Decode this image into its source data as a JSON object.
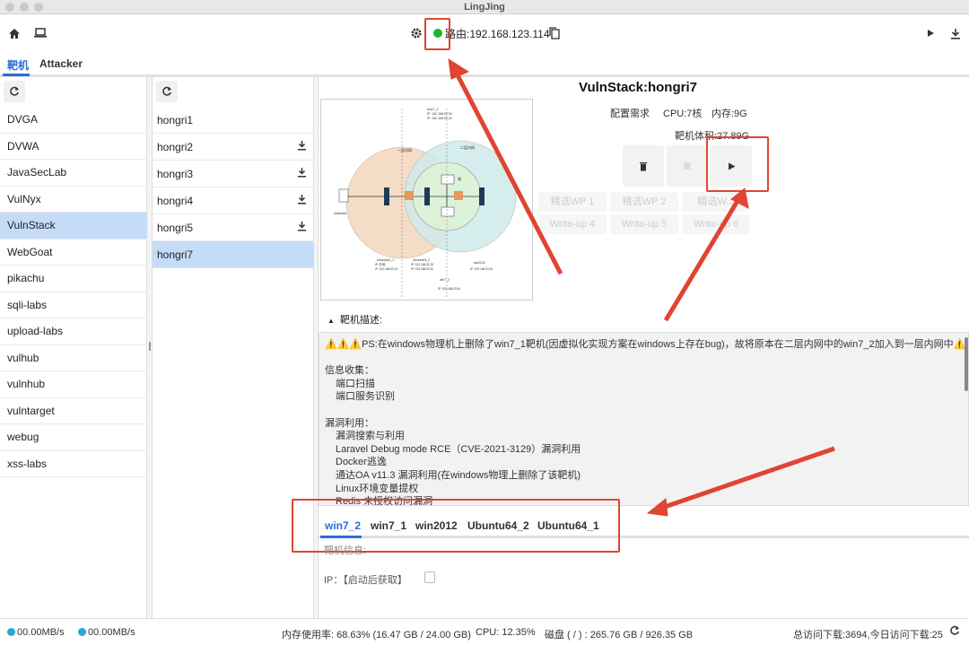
{
  "window": {
    "title": "LingJing"
  },
  "toolbar": {
    "route_text": "路由:192.168.123.114",
    "icons": [
      "home-icon",
      "laptop-icon",
      "gear-icon",
      "copy-icon",
      "play-icon",
      "download-icon"
    ]
  },
  "tabs": [
    {
      "label": "靶机",
      "active": true
    },
    {
      "label": "Attacker",
      "active": false
    }
  ],
  "labs": {
    "items": [
      "DVGA",
      "DVWA",
      "JavaSecLab",
      "VulNyx",
      "VulnStack",
      "WebGoat",
      "pikachu",
      "sqli-labs",
      "upload-labs",
      "vulhub",
      "vulnhub",
      "vulntarget",
      "webug",
      "xss-labs"
    ],
    "selected": "VulnStack"
  },
  "targets": {
    "items": [
      {
        "name": "hongri1",
        "download": false
      },
      {
        "name": "hongri2",
        "download": true
      },
      {
        "name": "hongri3",
        "download": true
      },
      {
        "name": "hongri4",
        "download": true
      },
      {
        "name": "hongri5",
        "download": true
      },
      {
        "name": "hongri7",
        "download": false
      }
    ],
    "selected": "hongri7"
  },
  "detail": {
    "title": "VulnStack:hongri7",
    "req_label": "配置需求",
    "cpu": "CPU:7核",
    "mem": "内存:9G",
    "size": "靶机体积:27.89G",
    "wp_buttons": [
      "精选WP 1",
      "精选WP 2",
      "精选W...",
      "Write-up 4",
      "Write-up 5",
      "Write-up 6"
    ],
    "desc_label": "靶机描述:",
    "desc_lines": [
      {
        "text": "⚠️⚠️⚠️PS:在windows物理机上删除了win7_1靶机(因虚拟化实现方案在windows上存在bug)，故将原本在二层内网中的win7_2加入到一层内网中⚠️⚠️⚠️",
        "indent": false
      },
      {
        "text": "",
        "indent": false
      },
      {
        "text": "信息收集：",
        "indent": false
      },
      {
        "text": "端口扫描",
        "indent": true
      },
      {
        "text": "端口服务识别",
        "indent": true
      },
      {
        "text": "",
        "indent": false
      },
      {
        "text": "漏洞利用：",
        "indent": false
      },
      {
        "text": "漏洞搜索与利用",
        "indent": true
      },
      {
        "text": "Laravel Debug mode RCE（CVE-2021-3129）漏洞利用",
        "indent": true
      },
      {
        "text": "Docker逃逸",
        "indent": true
      },
      {
        "text": "通达OA v11.3 漏洞利用(在windows物理上删除了该靶机)",
        "indent": true
      },
      {
        "text": "Linux环境变量提权",
        "indent": true
      },
      {
        "text": "Redis 未授权访问漏洞",
        "indent": true
      }
    ],
    "host_tabs": [
      "win7_2",
      "win7_1",
      "win2012",
      "Ubuntu64_2",
      "Ubuntu64_1"
    ],
    "host_active": "win7_2",
    "info_label": "靶机信息:",
    "ip_text": "IP：【启动后获取】"
  },
  "diagram": {
    "labels": [
      "win7_1",
      "IP: 192.168.52.30",
      "IP: 192.168.93.20",
      "一层内网",
      "二层内网",
      "域",
      "Attacker",
      "Ubuntu64_1",
      "Ubuntu64_2",
      "win2012",
      "win7_2",
      "IP: 192.168.52.10",
      "IP: 192.168.52.20",
      "IP: 192.168.93.10",
      "IP: 192.168.93.30",
      "IP: 192.168.93.40",
      "IP: 外网"
    ]
  },
  "status": {
    "up": "00.00MB/s",
    "down": "00.00MB/s",
    "mem": "内存使用率: 68.63% (16.47 GB / 24.00 GB)",
    "cpu": "CPU: 12.35%",
    "disk": "磁盘 ( / ) : 265.76 GB / 926.35 GB",
    "visits": "总访问下载:3694,今日访问下载:25"
  },
  "colors": {
    "accent": "#2a6fd6",
    "annotation": "#e04432",
    "selected_row": "#c5dcf8",
    "online": "#1fb42a"
  }
}
